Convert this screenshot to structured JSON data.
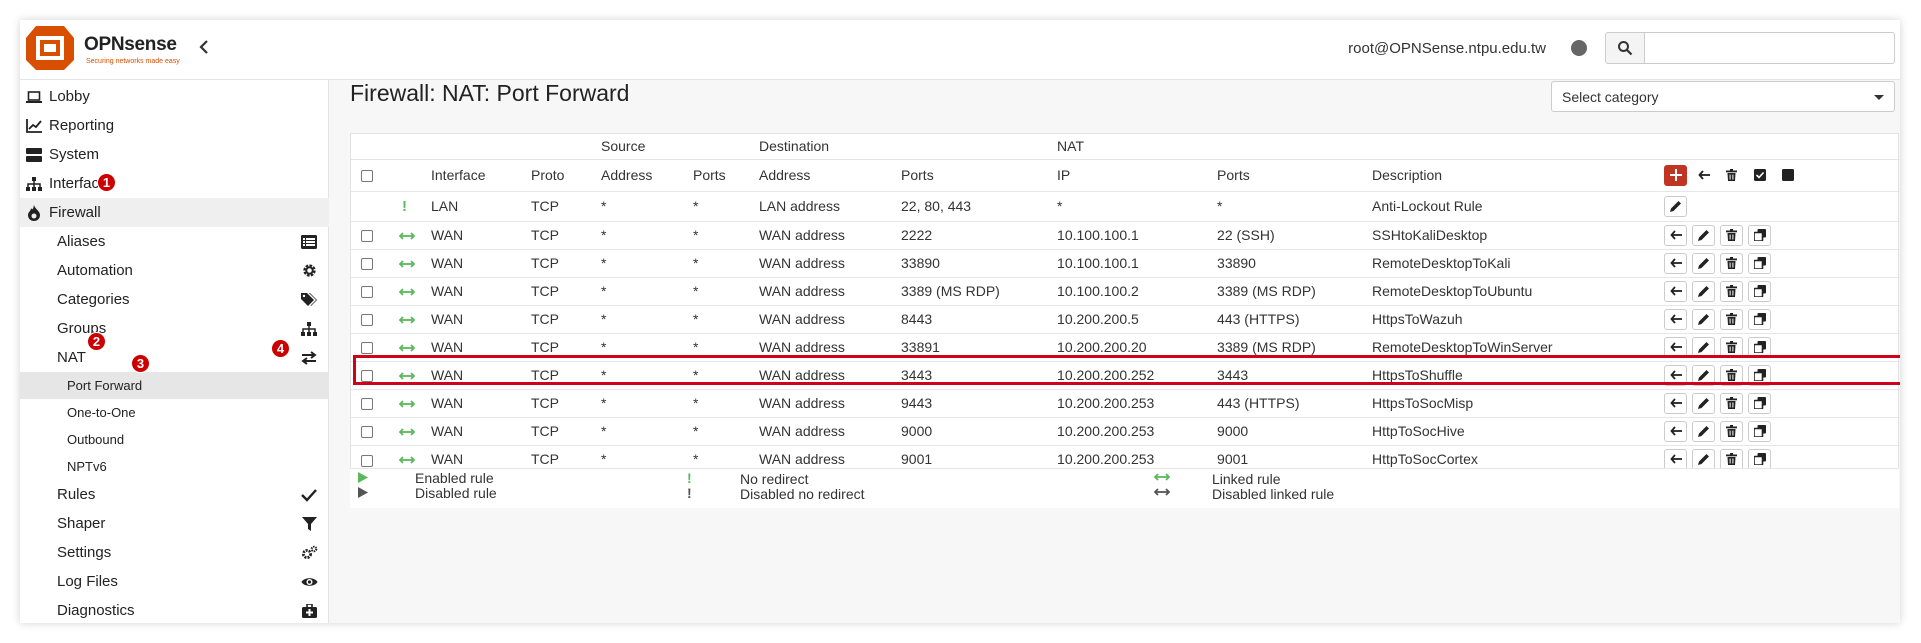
{
  "header": {
    "logo_text": "OPNsense",
    "logo_tagline": "Securing networks made easy",
    "user": "root@OPNSense.ntpu.edu.tw",
    "search_placeholder": ""
  },
  "sidebar": {
    "items": [
      {
        "label": "Lobby",
        "icon": "laptop-icon"
      },
      {
        "label": "Reporting",
        "icon": "chart-icon"
      },
      {
        "label": "System",
        "icon": "server-icon"
      },
      {
        "label": "Interfaces",
        "icon": "sitemap-icon"
      },
      {
        "label": "Firewall",
        "icon": "fire-icon"
      }
    ],
    "firewall_sub": [
      {
        "label": "Aliases",
        "icon": "list-icon"
      },
      {
        "label": "Automation",
        "icon": "gear-icon"
      },
      {
        "label": "Categories",
        "icon": "tags-icon"
      },
      {
        "label": "Groups",
        "icon": "sitemap-icon"
      },
      {
        "label": "NAT",
        "icon": "exchange-icon"
      }
    ],
    "nat_sub": [
      "Port Forward",
      "One-to-One",
      "Outbound",
      "NPTv6"
    ],
    "firewall_sub2": [
      {
        "label": "Rules",
        "icon": "check-icon"
      },
      {
        "label": "Shaper",
        "icon": "filter-icon"
      },
      {
        "label": "Settings",
        "icon": "gears-icon"
      },
      {
        "label": "Log Files",
        "icon": "eye-icon"
      },
      {
        "label": "Diagnostics",
        "icon": "medkit-icon"
      }
    ]
  },
  "callouts": [
    "1",
    "2",
    "3",
    "4"
  ],
  "page": {
    "title": "Firewall: NAT: Port Forward",
    "category_select": "Select category"
  },
  "table": {
    "group_headers": {
      "source": "Source",
      "destination": "Destination",
      "nat": "NAT"
    },
    "columns": [
      "Interface",
      "Proto",
      "Address",
      "Ports",
      "Address",
      "Ports",
      "IP",
      "Ports",
      "Description"
    ],
    "rows": [
      {
        "interface": "LAN",
        "proto": "TCP",
        "src_addr": "*",
        "src_ports": "*",
        "dst_addr": "LAN address",
        "dst_ports": "22, 80, 443",
        "nat_ip": "*",
        "nat_ports": "*",
        "description": "Anti-Lockout Rule"
      },
      {
        "interface": "WAN",
        "proto": "TCP",
        "src_addr": "*",
        "src_ports": "*",
        "dst_addr": "WAN address",
        "dst_ports": "2222",
        "nat_ip": "10.100.100.1",
        "nat_ports": "22 (SSH)",
        "description": "SSHtoKaliDesktop"
      },
      {
        "interface": "WAN",
        "proto": "TCP",
        "src_addr": "*",
        "src_ports": "*",
        "dst_addr": "WAN address",
        "dst_ports": "33890",
        "nat_ip": "10.100.100.1",
        "nat_ports": "33890",
        "description": "RemoteDesktopToKali"
      },
      {
        "interface": "WAN",
        "proto": "TCP",
        "src_addr": "*",
        "src_ports": "*",
        "dst_addr": "WAN address",
        "dst_ports": "3389 (MS RDP)",
        "nat_ip": "10.100.100.2",
        "nat_ports": "3389 (MS RDP)",
        "description": "RemoteDesktopToUbuntu"
      },
      {
        "interface": "WAN",
        "proto": "TCP",
        "src_addr": "*",
        "src_ports": "*",
        "dst_addr": "WAN address",
        "dst_ports": "8443",
        "nat_ip": "10.200.200.5",
        "nat_ports": "443 (HTTPS)",
        "description": "HttpsToWazuh"
      },
      {
        "interface": "WAN",
        "proto": "TCP",
        "src_addr": "*",
        "src_ports": "*",
        "dst_addr": "WAN address",
        "dst_ports": "33891",
        "nat_ip": "10.200.200.20",
        "nat_ports": "3389 (MS RDP)",
        "description": "RemoteDesktopToWinServer"
      },
      {
        "interface": "WAN",
        "proto": "TCP",
        "src_addr": "*",
        "src_ports": "*",
        "dst_addr": "WAN address",
        "dst_ports": "3443",
        "nat_ip": "10.200.200.252",
        "nat_ports": "3443",
        "description": "HttpsToShuffle"
      },
      {
        "interface": "WAN",
        "proto": "TCP",
        "src_addr": "*",
        "src_ports": "*",
        "dst_addr": "WAN address",
        "dst_ports": "9443",
        "nat_ip": "10.200.200.253",
        "nat_ports": "443 (HTTPS)",
        "description": "HttpsToSocMisp"
      },
      {
        "interface": "WAN",
        "proto": "TCP",
        "src_addr": "*",
        "src_ports": "*",
        "dst_addr": "WAN address",
        "dst_ports": "9000",
        "nat_ip": "10.200.200.253",
        "nat_ports": "9000",
        "description": "HttpToSocHive"
      },
      {
        "interface": "WAN",
        "proto": "TCP",
        "src_addr": "*",
        "src_ports": "*",
        "dst_addr": "WAN address",
        "dst_ports": "9001",
        "nat_ip": "10.200.200.253",
        "nat_ports": "9001",
        "description": "HttpToSocCortex"
      }
    ]
  },
  "legend": {
    "enabled": "Enabled rule",
    "disabled": "Disabled rule",
    "no_redirect": "No redirect",
    "disabled_no_redirect": "Disabled no redirect",
    "linked": "Linked rule",
    "disabled_linked": "Disabled linked rule"
  },
  "colors": {
    "brand": "#d94f00",
    "add_button": "#c03423",
    "enabled_green": "#5cb85c",
    "highlight": "#d0021b",
    "callout": "#cc0000"
  }
}
